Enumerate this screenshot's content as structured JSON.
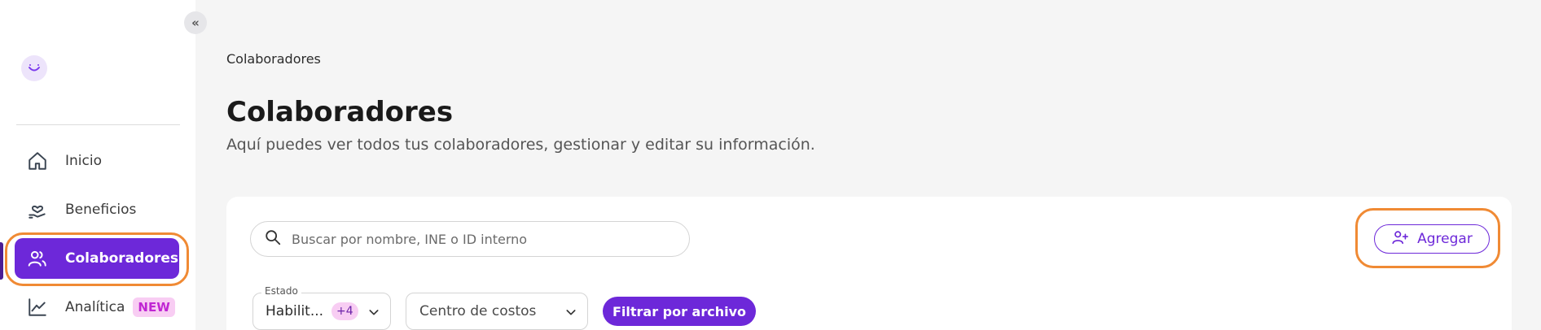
{
  "sidebar": {
    "collapse_label": "«",
    "items": [
      {
        "label": "Inicio",
        "icon": "home-icon"
      },
      {
        "label": "Beneficios",
        "icon": "hand-heart-icon"
      },
      {
        "label": "Colaboradores",
        "icon": "users-icon",
        "active": true
      },
      {
        "label": "Analítica",
        "icon": "chart-line-icon",
        "badge": "NEW"
      }
    ]
  },
  "breadcrumb": "Colaboradores",
  "page": {
    "title": "Colaboradores",
    "subtitle": "Aquí puedes ver todos tus colaboradores, gestionar y editar su información."
  },
  "search": {
    "placeholder": "Buscar por nombre, INE o ID interno",
    "icon": "search-icon"
  },
  "add_button": {
    "label": "Agregar",
    "icon": "user-plus-icon"
  },
  "filters": {
    "estado": {
      "legend": "Estado",
      "value": "Habilit...",
      "extra_count": "+4"
    },
    "centro": {
      "placeholder": "Centro de costos"
    },
    "file_button": "Filtrar por archivo"
  },
  "colors": {
    "primary": "#6d28d9",
    "highlight": "#f08a34",
    "badge_bg": "#f8cdf3",
    "badge_text": "#c026d3"
  }
}
